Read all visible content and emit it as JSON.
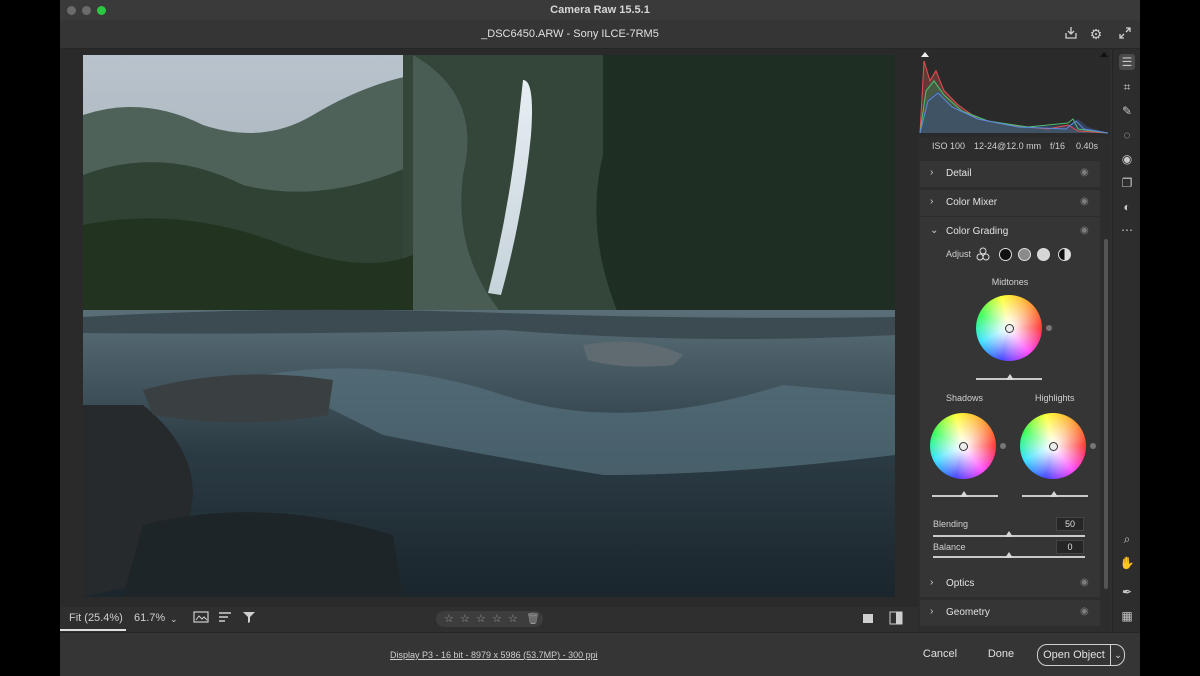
{
  "window": {
    "title": "Camera Raw 15.5.1"
  },
  "file": {
    "name": "_DSC6450.ARW  -  Sony ILCE-7RM5"
  },
  "camera_info": {
    "iso": "ISO 100",
    "lens": "12-24@12.0 mm",
    "aperture": "f/16",
    "shutter": "0.40s"
  },
  "panels": {
    "detail": "Detail",
    "color_mixer": "Color Mixer",
    "color_grading": "Color Grading",
    "optics": "Optics",
    "geometry": "Geometry"
  },
  "color_grading": {
    "adjust_label": "Adjust",
    "midtones_label": "Midtones",
    "shadows_label": "Shadows",
    "highlights_label": "Highlights",
    "blending_label": "Blending",
    "blending_value": "50",
    "balance_label": "Balance",
    "balance_value": "0"
  },
  "zoom": {
    "fit": "Fit (25.4%)",
    "level": "61.7%"
  },
  "footer": {
    "display_info": "Display P3 - 16 bit - 8979 x 5986 (53.7MP) - 300 ppi",
    "cancel": "Cancel",
    "done": "Done",
    "open": "Open Object"
  },
  "colors": {
    "accent": "#ffffff",
    "panel_bg": "#353535",
    "window_bg": "#2f2f2f"
  }
}
